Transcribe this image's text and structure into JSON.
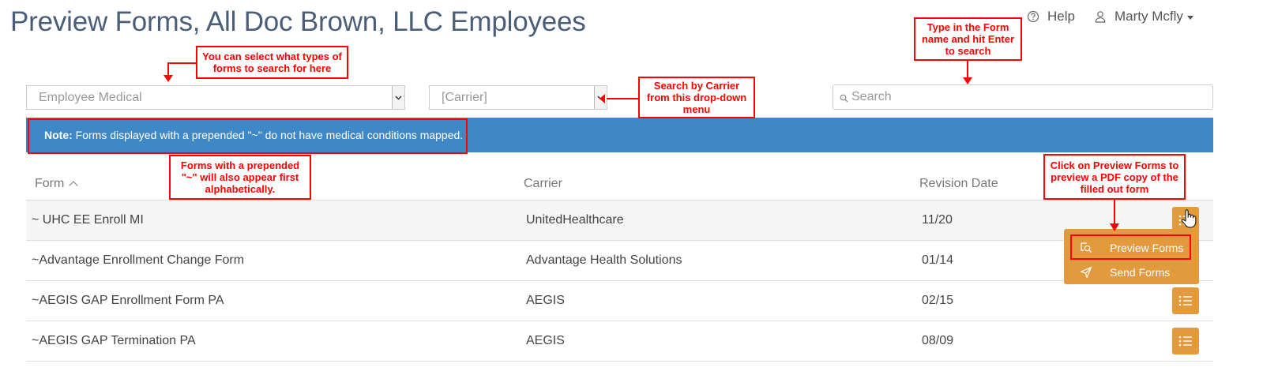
{
  "page": {
    "title": "Preview Forms, All Doc Brown, LLC Employees"
  },
  "topbar": {
    "help_label": "Help",
    "user_name": "Marty Mcfly"
  },
  "filters": {
    "form_type": "Employee Medical",
    "carrier": "[Carrier]",
    "search_placeholder": "Search"
  },
  "note": {
    "label": "Note:",
    "text": "Forms displayed with a prepended \"~\" do not have medical conditions mapped."
  },
  "table": {
    "columns": [
      "Form",
      "Carrier",
      "Revision Date"
    ],
    "rows": [
      {
        "form": "~ UHC EE Enroll MI",
        "carrier": "UnitedHealthcare",
        "date": "11/20"
      },
      {
        "form": "~Advantage Enrollment Change Form",
        "carrier": "Advantage Health Solutions",
        "date": "01/14"
      },
      {
        "form": "~AEGIS GAP Enrollment Form PA",
        "carrier": "AEGIS",
        "date": "02/15"
      },
      {
        "form": "~AEGIS GAP Termination PA",
        "carrier": "AEGIS",
        "date": "08/09"
      }
    ]
  },
  "action_menu": {
    "preview": "Preview Forms",
    "send": "Send Forms"
  },
  "callouts": {
    "form_type": "You can select what types of forms to search for here",
    "carrier": "Search by Carrier from this drop-down menu",
    "search": "Type in the Form name and hit Enter to search",
    "prepended": "Forms with a prepended \"~\" will also appear first alphabetically.",
    "preview": "Click on Preview Forms to preview a PDF copy of the filled out form"
  },
  "colors": {
    "accent": "#e29a3d",
    "note_bg": "#3f88c8",
    "annotation": "#ff0000",
    "title": "#4a5e7a"
  },
  "icons": {
    "help": "question-circle-icon",
    "user": "user-icon",
    "search": "search-icon",
    "action": "list-icon",
    "preview": "preview-icon",
    "send": "send-icon",
    "cursor": "hand-cursor-icon"
  }
}
